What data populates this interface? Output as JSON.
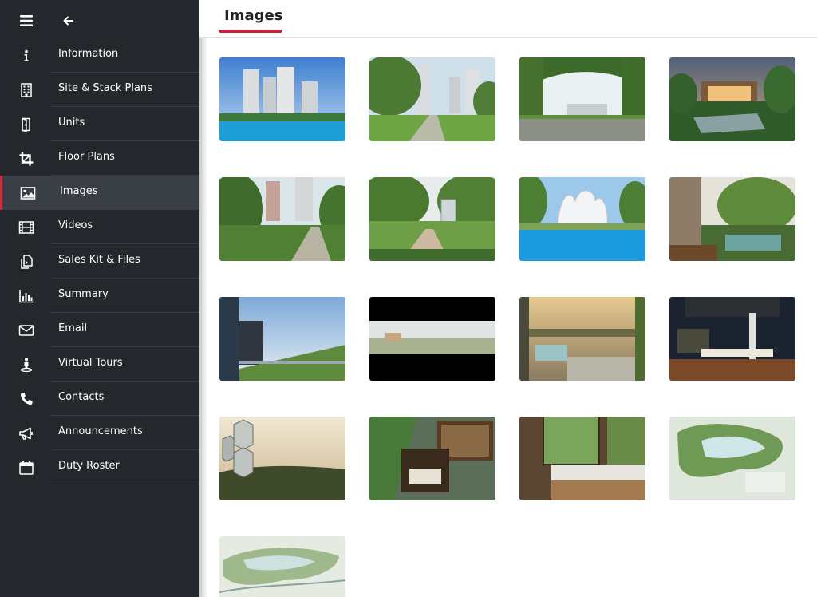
{
  "sidebar": {
    "items": [
      {
        "label": "Information",
        "icon": "info-icon"
      },
      {
        "label": "Site & Stack Plans",
        "icon": "building-icon"
      },
      {
        "label": "Units",
        "icon": "door-icon"
      },
      {
        "label": "Floor Plans",
        "icon": "crop-icon"
      },
      {
        "label": "Images",
        "icon": "image-icon",
        "active": true
      },
      {
        "label": "Videos",
        "icon": "film-icon"
      },
      {
        "label": "Sales Kit & Files",
        "icon": "files-icon"
      },
      {
        "label": "Summary",
        "icon": "bar-chart-icon"
      },
      {
        "label": "Email",
        "icon": "envelope-icon"
      },
      {
        "label": "Virtual Tours",
        "icon": "street-view-icon"
      },
      {
        "label": "Contacts",
        "icon": "phone-icon"
      },
      {
        "label": "Announcements",
        "icon": "megaphone-icon"
      },
      {
        "label": "Duty Roster",
        "icon": "calendar-icon"
      }
    ]
  },
  "header": {
    "title": "Images"
  },
  "colors": {
    "sidebar_bg": "#24272c",
    "active_bg": "#3a3e45",
    "accent": "#d7263d"
  },
  "gallery": {
    "images": [
      {
        "scene": "towers-pool"
      },
      {
        "scene": "towers-lawn"
      },
      {
        "scene": "tree-arch-entrance"
      },
      {
        "scene": "dusk-clubhouse"
      },
      {
        "scene": "garden-path-towers"
      },
      {
        "scene": "garden-pavilion"
      },
      {
        "scene": "pool-pavilion"
      },
      {
        "scene": "terrace-garden"
      },
      {
        "scene": "sky-terrace"
      },
      {
        "scene": "panorama-letterbox"
      },
      {
        "scene": "rooftop-lounge"
      },
      {
        "scene": "night-dining"
      },
      {
        "scene": "hex-pod-forest"
      },
      {
        "scene": "library-loft"
      },
      {
        "scene": "bathroom-view"
      },
      {
        "scene": "site-plan-color"
      },
      {
        "scene": "site-plan-light"
      }
    ]
  }
}
